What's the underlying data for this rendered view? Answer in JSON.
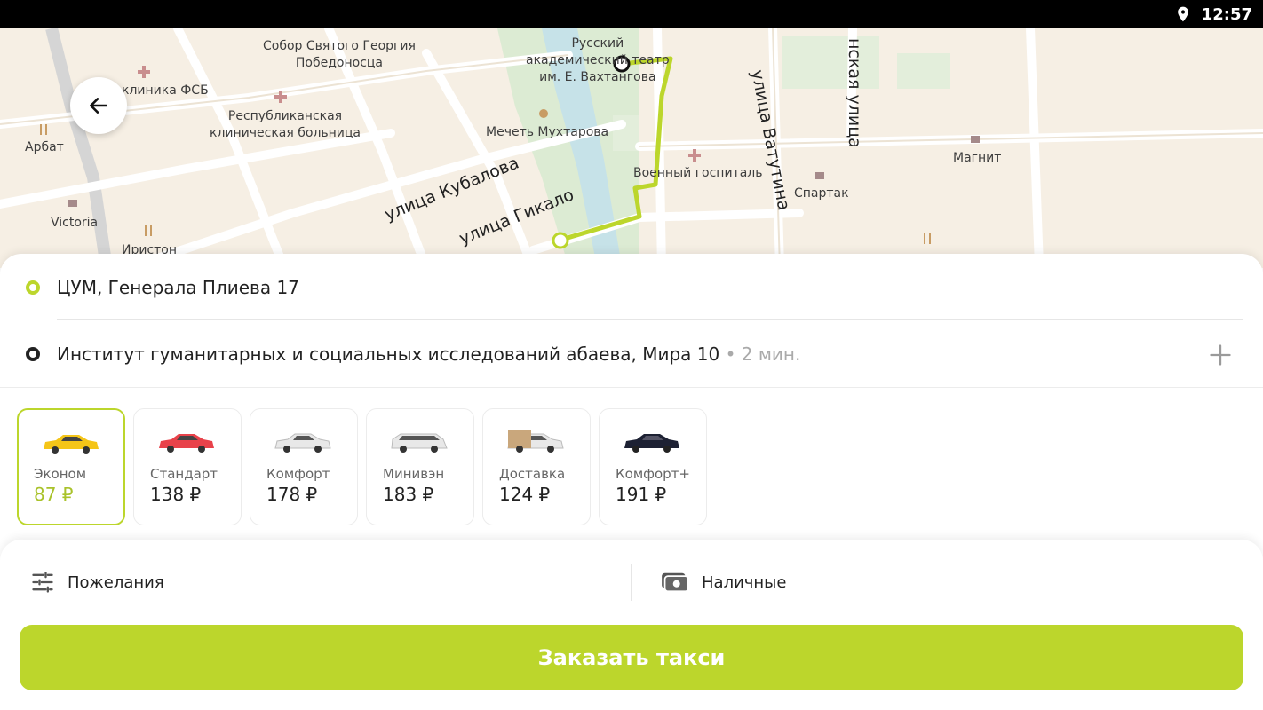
{
  "status_bar": {
    "time": "12:57",
    "icons": [
      "location-pin-icon"
    ]
  },
  "map": {
    "pois": [
      {
        "id": "sobor",
        "text": "Собор Святого Георгия\nПобедоносца"
      },
      {
        "id": "teatr",
        "text": "Русский\nакадемический театр\nим. Е. Вахтангова"
      },
      {
        "id": "klinika",
        "text": "клиника ФСБ"
      },
      {
        "id": "bolnica",
        "text": "Республиканская\nклиническая больница"
      },
      {
        "id": "arbat",
        "text": "Арбат"
      },
      {
        "id": "mechet",
        "text": "Мечеть Мухтарова"
      },
      {
        "id": "gospital",
        "text": "Военный госпиталь"
      },
      {
        "id": "magnit",
        "text": "Магнит"
      },
      {
        "id": "spartak",
        "text": "Спартак"
      },
      {
        "id": "victoria",
        "text": "Victoria"
      },
      {
        "id": "iriston",
        "text": "Ирistон"
      }
    ],
    "streets": [
      {
        "id": "kubalova",
        "text": "улица Кубалова"
      },
      {
        "id": "gikalo",
        "text": "улица Гикало"
      },
      {
        "id": "vatutina",
        "text": "улица Ватутина"
      },
      {
        "id": "top-right",
        "text": "нская улица"
      }
    ],
    "colors": {
      "route": "#bcd62c",
      "background": "#f6efe4",
      "park": "#dcebd3",
      "water": "#c6e2e8"
    }
  },
  "route": {
    "from": {
      "address": "ЦУМ, Генерала Плиева 17",
      "marker_color": "#bcd62c"
    },
    "to": {
      "address": "Институт гуманитарных и социальных исследований абаева, Мира 10",
      "eta": "• 2 мин.",
      "marker_color": "#222222"
    },
    "add_stop_icon": "plus-icon"
  },
  "tariffs": [
    {
      "name": "Эконом",
      "price": "87 ₽",
      "selected": true,
      "car_color": "#f5c518"
    },
    {
      "name": "Стандарт",
      "price": "138 ₽",
      "selected": false,
      "car_color": "#e8424a"
    },
    {
      "name": "Комфорт",
      "price": "178 ₽",
      "selected": false,
      "car_color": "#e8e8e8"
    },
    {
      "name": "Минивэн",
      "price": "183 ₽",
      "selected": false,
      "car_color": "#e8e8e8"
    },
    {
      "name": "Доставка",
      "price": "124 ₽",
      "selected": false,
      "car_color": "#e8e8e8"
    },
    {
      "name": "Комфорт+",
      "price": "191 ₽",
      "selected": false,
      "car_color": "#1d2133"
    }
  ],
  "options": {
    "wishes_label": "Пожелания",
    "wishes_icon": "sliders-icon",
    "payment_label": "Наличные",
    "payment_icon": "cash-icon"
  },
  "order_button": {
    "label": "Заказать такси",
    "color": "#bcd62c"
  }
}
